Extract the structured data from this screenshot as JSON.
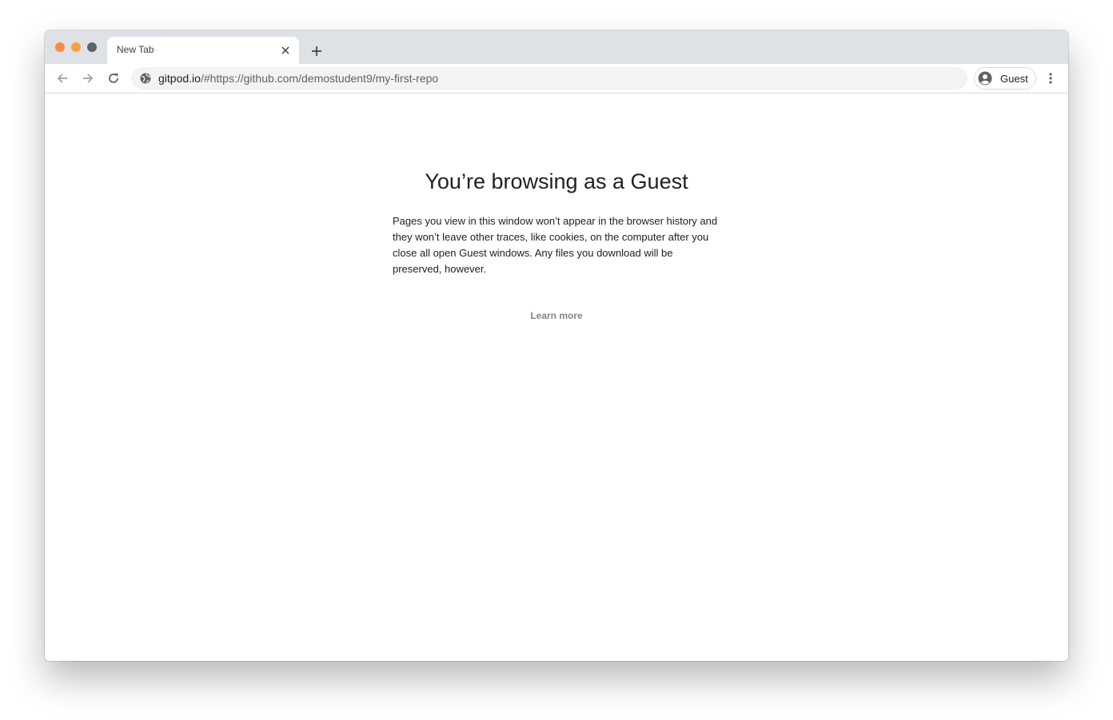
{
  "window": {
    "traffic_lights": {
      "close_color": "#ff8a3d",
      "minimize_color": "#ff9f3d",
      "zoom_color": "#5f6368"
    }
  },
  "tabs": [
    {
      "title": "New Tab",
      "active": true
    }
  ],
  "toolbar": {
    "url_host": "gitpod.io",
    "url_rest": "/#https://github.com/demostudent9/my-first-repo",
    "profile_label": "Guest",
    "icons": [
      "back-arrow-icon",
      "forward-arrow-icon",
      "reload-icon",
      "globe-icon",
      "guest-avatar-icon",
      "kebab-menu-icon"
    ]
  },
  "content": {
    "heading": "You’re browsing as a Guest",
    "description": "Pages you view in this window won’t appear in the browser history and they won’t leave other traces, like cookies, on the computer after you close all open Guest windows. Any files you download will be preserved, however.",
    "learn_more": "Learn more"
  },
  "colors": {
    "tabstrip_bg": "#dee1e6",
    "omnibox_bg": "#f1f3f4",
    "text_primary": "#202124",
    "text_secondary": "#5f6368",
    "link_muted": "#80868b"
  }
}
